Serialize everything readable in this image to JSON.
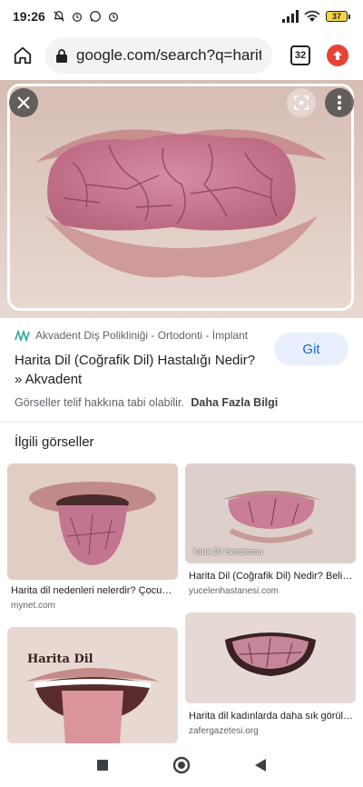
{
  "status_bar": {
    "time": "19:26",
    "battery": "37"
  },
  "browser": {
    "url": "google.com/search?q=harita",
    "tab_count": "32"
  },
  "result": {
    "source": "Akvadent Diş Polikliniği - Ortodonti - İmplant",
    "title": "Harita Dil (Coğrafik Dil) Hastalığı Nedir? » Akvadent",
    "visit_label": "Git",
    "copyright_note": "Görseller telif hakkına tabi olabilir.",
    "more_info": "Daha Fazla Bilgi"
  },
  "related": {
    "heading": "İlgili görseller",
    "items": [
      {
        "title": "Harita dil nedenleri nelerdir? Çocuklarda...",
        "source": "mynet.com",
        "overlay": ""
      },
      {
        "title": "Harita Dil (Coğrafik Dil) Nedir? Belirtileri...",
        "source": "yucelenhastanesi.com",
        "overlay": "Yarık Dil Sendromu"
      },
      {
        "title": "",
        "source": "",
        "overlay": "Harita Dil"
      },
      {
        "title": "Harita dil kadınlarda daha sık görülüyor",
        "source": "zafergazetesi.org",
        "overlay": ""
      }
    ]
  },
  "colors": {
    "accent": "#1967d2",
    "visit_bg": "#e8f0fe",
    "update": "#e94235",
    "battery": "#f6d54b"
  },
  "icons": [
    "mute-icon",
    "alarm-icon",
    "whatsapp-icon",
    "signal-icon",
    "wifi-icon",
    "battery-icon",
    "home-icon",
    "lock-icon",
    "tabs-icon",
    "update-icon",
    "close-icon",
    "lens-icon",
    "more-icon",
    "square-icon",
    "circle-icon",
    "back-icon"
  ]
}
